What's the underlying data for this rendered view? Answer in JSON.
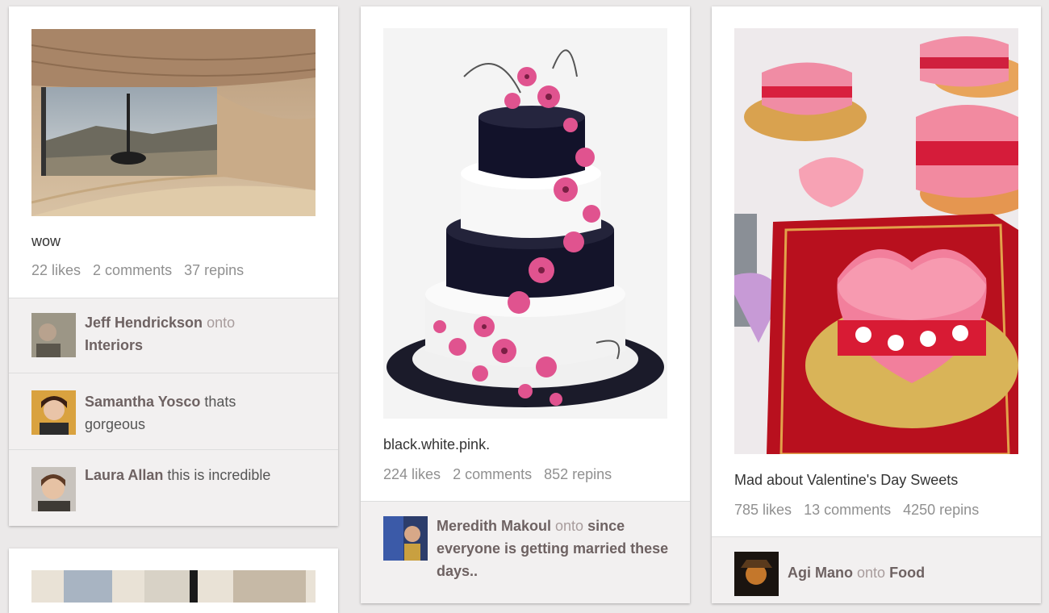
{
  "pins": [
    {
      "title": "wow",
      "likes": "22 likes",
      "comments": "2 comments",
      "repins": "37 repins",
      "activities": [
        {
          "user": "Jeff Hendrickson",
          "connector": "onto",
          "board": "Interiors"
        },
        {
          "user": "Samantha Yosco",
          "comment": "thats gorgeous"
        },
        {
          "user": "Laura Allan",
          "comment": "this is incredible"
        }
      ]
    },
    {
      "title": "black.white.pink.",
      "likes": "224 likes",
      "comments": "2 comments",
      "repins": "852 repins",
      "activities": [
        {
          "user": "Meredith Makoul",
          "connector": "onto",
          "board": "since everyone is getting married these days.."
        }
      ]
    },
    {
      "title": "Mad about Valentine's Day Sweets",
      "likes": "785 likes",
      "comments": "13 comments",
      "repins": "4250 repins",
      "activities": [
        {
          "user": "Agi Mano",
          "connector": "onto",
          "board": "Food"
        }
      ]
    }
  ],
  "colors": {
    "background": "#ebe9e9",
    "card": "#ffffff",
    "activity_bg": "#f2f0f0",
    "username": "#6e6262",
    "stats": "#909090"
  }
}
